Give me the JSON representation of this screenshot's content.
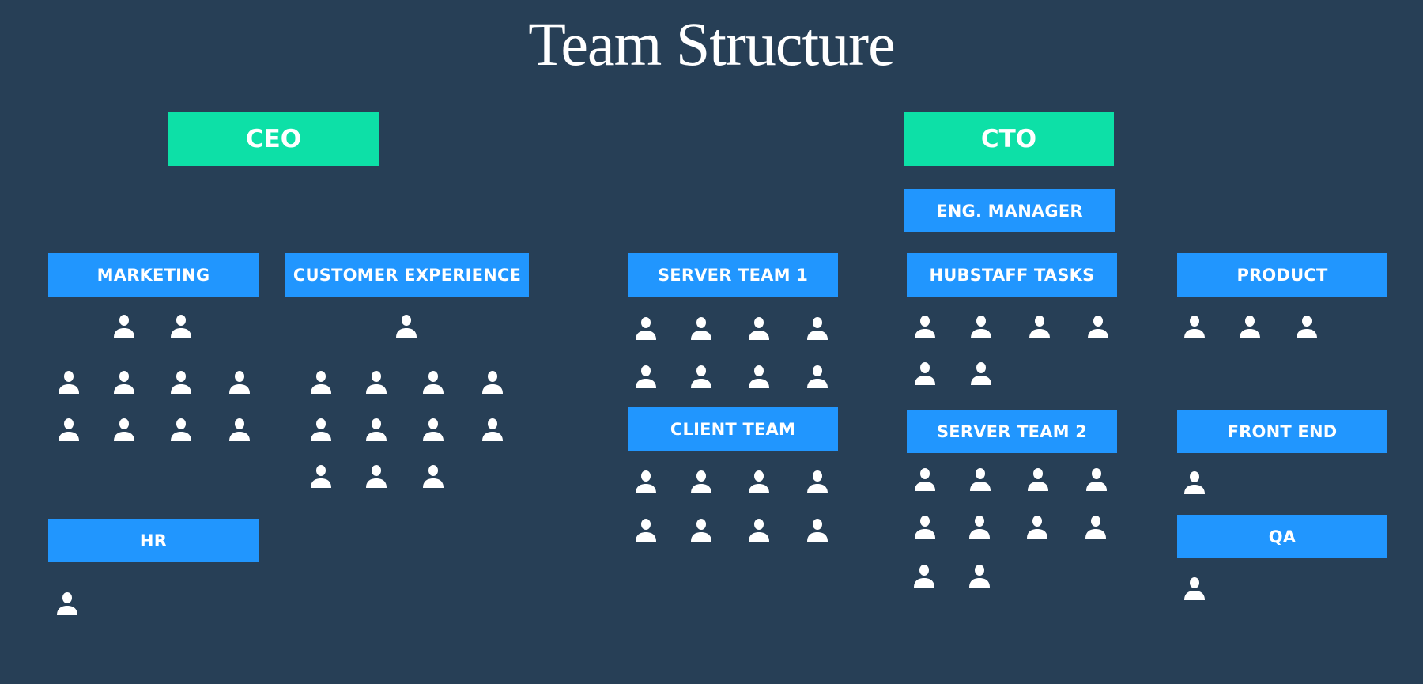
{
  "title": "Team Structure",
  "colors": {
    "background": "#273f56",
    "executive": "#0de0a7",
    "team": "#2196fe",
    "text": "#ffffff"
  },
  "executives": [
    {
      "id": "ceo",
      "label": "CEO"
    },
    {
      "id": "cto",
      "label": "CTO"
    }
  ],
  "teams": [
    {
      "id": "marketing",
      "label": "MARKETING",
      "reports_to": "CEO",
      "members": 10
    },
    {
      "id": "customer-experience",
      "label": "CUSTOMER EXPERIENCE",
      "reports_to": "CEO",
      "members": 12
    },
    {
      "id": "hr",
      "label": "HR",
      "reports_to": "CEO",
      "members": 1
    },
    {
      "id": "eng-manager",
      "label": "ENG. MANAGER",
      "reports_to": "CTO",
      "members": 0
    },
    {
      "id": "server-team-1",
      "label": "SERVER TEAM 1",
      "reports_to": "CTO",
      "members": 8
    },
    {
      "id": "client-team",
      "label": "CLIENT TEAM",
      "reports_to": "CTO",
      "members": 8
    },
    {
      "id": "hubstaff-tasks",
      "label": "HUBSTAFF TASKS",
      "reports_to": "CTO",
      "members": 6
    },
    {
      "id": "server-team-2",
      "label": "SERVER TEAM 2",
      "reports_to": "CTO",
      "members": 10
    },
    {
      "id": "product",
      "label": "PRODUCT",
      "reports_to": "CTO",
      "members": 3
    },
    {
      "id": "front-end",
      "label": "FRONT END",
      "reports_to": "CTO",
      "members": 1
    },
    {
      "id": "qa",
      "label": "QA",
      "reports_to": "CTO",
      "members": 1
    }
  ],
  "icons": {
    "member": "person-icon"
  }
}
